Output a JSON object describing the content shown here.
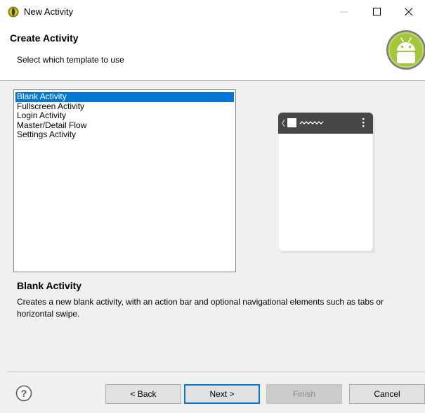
{
  "window": {
    "title": "New Activity"
  },
  "header": {
    "title": "Create Activity",
    "subtitle": "Select which template to use"
  },
  "templates": [
    "Blank Activity",
    "Fullscreen Activity",
    "Login Activity",
    "Master/Detail Flow",
    "Settings Activity"
  ],
  "selected_template": "Blank Activity",
  "description": {
    "title": "Blank Activity",
    "text": "Creates a new blank activity, with an action bar and optional navigational elements such as tabs or horizontal swipe."
  },
  "buttons": {
    "back": "< Back",
    "next": "Next >",
    "finish": "Finish",
    "cancel": "Cancel"
  },
  "colors": {
    "selection": "#0078d7",
    "android_green": "#a4c639",
    "action_bar": "#474747"
  },
  "icons": [
    "app-icon",
    "minimize-icon",
    "maximize-icon",
    "close-icon",
    "android-logo-icon",
    "help-icon"
  ]
}
